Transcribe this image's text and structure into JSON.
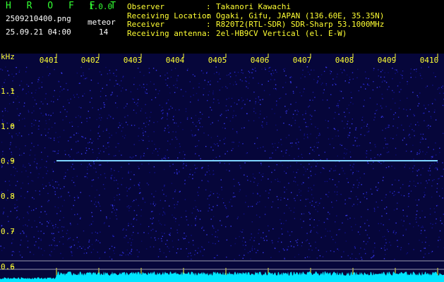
{
  "app": {
    "name": "H R O F F T",
    "version": "1.0.0"
  },
  "file": {
    "name": "2509210400.png",
    "datetime": "25.09.21 04:00"
  },
  "meteor": {
    "label": "meteor",
    "count": "14"
  },
  "station": [
    {
      "key": "Observer",
      "value": "Takanori Kawachi"
    },
    {
      "key": "Receiving Location",
      "value": "Ogaki, Gifu, JAPAN (136.60E, 35.35N)"
    },
    {
      "key": "Receiver",
      "value": "R820T2(RTL-SDR) SDR-Sharp 53.1000MHz"
    },
    {
      "key": "Receiving antenna",
      "value": "2el-HB9CV Vertical (el. E-W)"
    }
  ],
  "axis": {
    "unit": "kHz",
    "time_labels": [
      "0401",
      "0402",
      "0403",
      "0404",
      "0405",
      "0406",
      "0407",
      "0408",
      "0409",
      "0410"
    ],
    "freq_labels": [
      "1.1",
      "1.0",
      "0.9",
      "0.8",
      "0.7",
      "0.6"
    ],
    "freq_range_khz": [
      0.57,
      1.2
    ]
  },
  "colors": {
    "background": "#000000",
    "spectrum_bg": "#06063a",
    "carrier": "#7fd6ff",
    "noise_band": "#00e5ff",
    "label_yellow": "#ffff33",
    "title_green": "#33ff33"
  }
}
